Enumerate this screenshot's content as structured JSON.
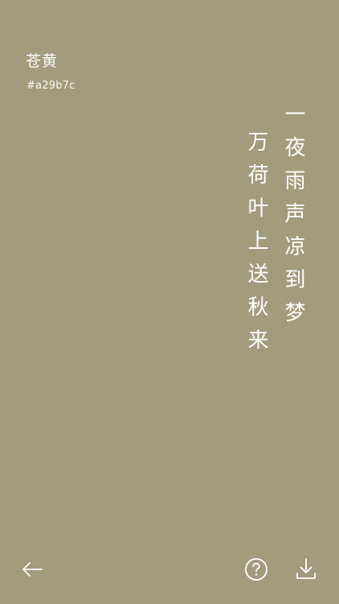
{
  "color": {
    "name": "苍黄",
    "hex": "#a29b7c"
  },
  "poem": {
    "lines": [
      "一夜雨声凉到梦",
      "万荷叶上送秋来"
    ]
  },
  "toolbar": {
    "back_icon": "arrow-left-icon",
    "help_icon": "question-circle-icon",
    "download_icon": "download-icon"
  },
  "theme": {
    "background": "#a29b7c",
    "foreground": "#ffffff"
  }
}
